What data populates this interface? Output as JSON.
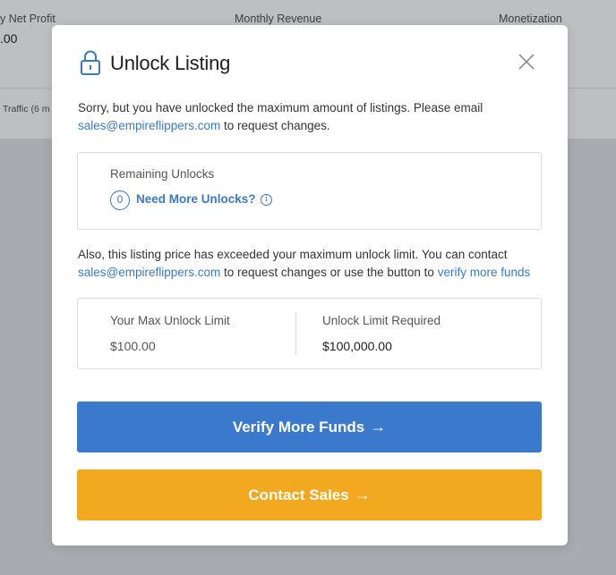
{
  "background": {
    "col1_label": "y Net Profit",
    "col1_value": ".00",
    "col2_label": "Monthly Revenue",
    "col3_label": "Monetization",
    "traffic_label": "Traffic (6 m"
  },
  "modal": {
    "title": "Unlock Listing",
    "intro_text": "Sorry, but you have unlocked the maximum amount of listings. Please email",
    "email": "sales@empireflippers.com",
    "intro_suffix": "to request changes.",
    "remaining": {
      "label": "Remaining Unlocks",
      "count": "0",
      "need_more": "Need More Unlocks?",
      "info_glyph": "i"
    },
    "limit_text": "Also, this listing price has exceeded your maximum unlock limit. You can contact",
    "limit_suffix": "to request changes or use the button to",
    "verify_link": "verify more funds",
    "limits": {
      "max_label": "Your Max Unlock Limit",
      "max_value": "$100.00",
      "required_label": "Unlock Limit Required",
      "required_value": "$100,000.00"
    },
    "verify_button": "Verify More Funds",
    "contact_button": "Contact Sales",
    "arrow_glyph": "→"
  },
  "colors": {
    "accent_blue": "#3a79cb",
    "accent_orange": "#f2a81f",
    "link_blue": "#3a7ac4"
  },
  "icons": [
    "lock-icon",
    "close-icon",
    "info-icon",
    "arrow-right-icon"
  ]
}
